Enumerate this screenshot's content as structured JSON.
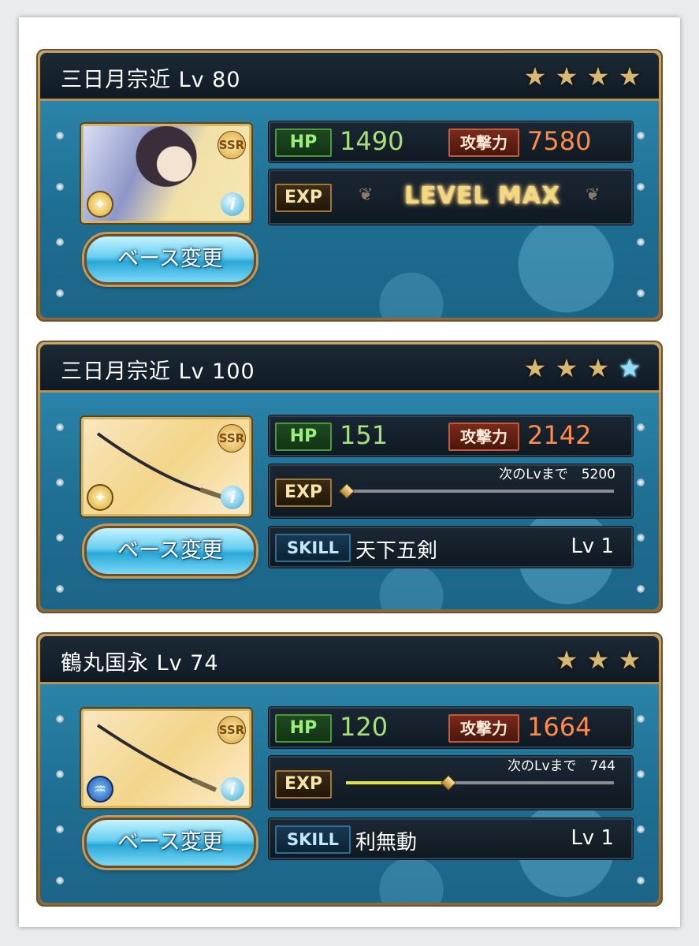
{
  "cards": [
    {
      "name": "三日月宗近 Lv 80",
      "stars": [
        "gold",
        "gold",
        "gold",
        "gold"
      ],
      "portrait": "character",
      "rarity": "SSR",
      "element": "light",
      "hp_label": "HP",
      "hp": "1490",
      "atk_label": "攻撃力",
      "atk": "7580",
      "exp_label": "EXP",
      "exp_status": "LEVEL MAX",
      "base_button": "ベース変更"
    },
    {
      "name": "三日月宗近 Lv 100",
      "stars": [
        "gold",
        "gold",
        "gold",
        "blue"
      ],
      "portrait": "sword",
      "rarity": "SSR",
      "element": "light",
      "hp_label": "HP",
      "hp": "151",
      "atk_label": "攻撃力",
      "atk": "2142",
      "exp_label": "EXP",
      "next_lv": "次のLvまで　5200",
      "exp_progress": 0,
      "skill_label": "SKILL",
      "skill": "天下五剣",
      "skill_lv": "Lv 1",
      "base_button": "ベース変更"
    },
    {
      "name": "鶴丸国永 Lv 74",
      "stars": [
        "gold",
        "gold",
        "gold"
      ],
      "portrait": "sword",
      "rarity": "SSR",
      "element": "water",
      "hp_label": "HP",
      "hp": "120",
      "atk_label": "攻撃力",
      "atk": "1664",
      "exp_label": "EXP",
      "next_lv": "次のLvまで　744",
      "exp_progress": 0.38,
      "skill_label": "SKILL",
      "skill": "利無動",
      "skill_lv": "Lv 1",
      "base_button": "ベース変更"
    }
  ],
  "icons": {
    "star": "star-icon",
    "info": "info-icon",
    "light_element": "light-element-icon",
    "water_element": "water-element-icon"
  }
}
